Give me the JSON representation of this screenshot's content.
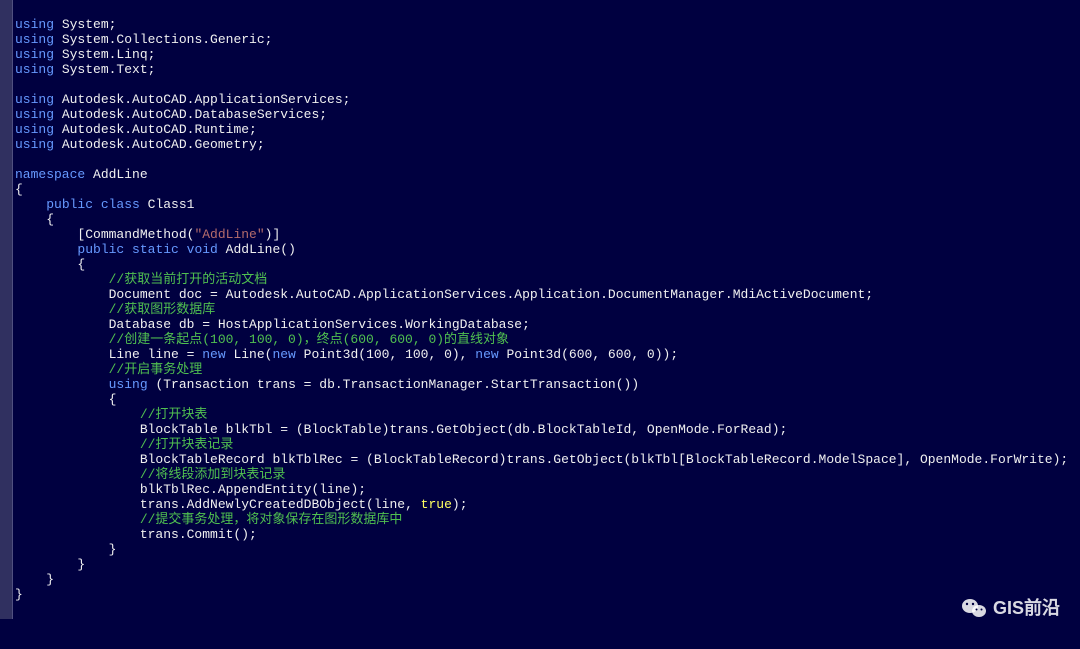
{
  "code": {
    "u1a": "using",
    "u1b": " System;",
    "u2a": "using",
    "u2b": " System.Collections.Generic;",
    "u3a": "using",
    "u3b": " System.Linq;",
    "u4a": "using",
    "u4b": " System.Text;",
    "u5a": "using",
    "u5b": " Autodesk.AutoCAD.ApplicationServices;",
    "u6a": "using",
    "u6b": " Autodesk.AutoCAD.DatabaseServices;",
    "u7a": "using",
    "u7b": " Autodesk.AutoCAD.Runtime;",
    "u8a": "using",
    "u8b": " Autodesk.AutoCAD.Geometry;",
    "nsKw": "namespace",
    "nsName": " AddLine",
    "obrace1": "{",
    "pub": "public",
    "cls": " class",
    "clsName": " Class1",
    "obrace2": "    {",
    "attr1": "        [CommandMethod(",
    "attrStr": "\"AddLine\"",
    "attr2": ")]",
    "mpub": "public",
    "mstatic": " static",
    "mvoid": " void",
    "mname": " AddLine()",
    "obrace3": "        {",
    "c1": "            //获取当前打开的活动文档",
    "l1": "            Document doc = Autodesk.AutoCAD.ApplicationServices.Application.DocumentManager.MdiActiveDocument;",
    "c2": "            //获取图形数据库",
    "l2": "            Database db = HostApplicationServices.WorkingDatabase;",
    "c3": "            //创建一条起点(100, 100, 0)，终点(600, 600, 0)的直线对象",
    "l3a": "            Line line = ",
    "new1": "new",
    "l3b": " Line(",
    "new2": "new",
    "l3c": " Point3d(100, 100, 0), ",
    "new3": "new",
    "l3d": " Point3d(600, 600, 0));",
    "c4": "            //开启事务处理",
    "l4a": "using",
    "l4b": " (Transaction trans = db.TransactionManager.StartTransaction())",
    "obrace4": "            {",
    "c5": "                //打开块表",
    "l5": "                BlockTable blkTbl = (BlockTable)trans.GetObject(db.BlockTableId, OpenMode.ForRead);",
    "c6": "                //打开块表记录",
    "l6": "                BlockTableRecord blkTblRec = (BlockTableRecord)trans.GetObject(blkTbl[BlockTableRecord.ModelSpace], OpenMode.ForWrite);",
    "c7": "                //将线段添加到块表记录",
    "l7": "                blkTblRec.AppendEntity(line);",
    "l8a": "                trans.AddNewlyCreatedDBObject(line, ",
    "true": "true",
    "l8b": ");",
    "c8": "                //提交事务处理，将对象保存在图形数据库中",
    "l9": "                trans.Commit();",
    "cbrace4": "            }",
    "cbrace3": "        }",
    "cbrace2": "    }",
    "cbrace1": "}"
  },
  "watermark": "GIS前沿"
}
